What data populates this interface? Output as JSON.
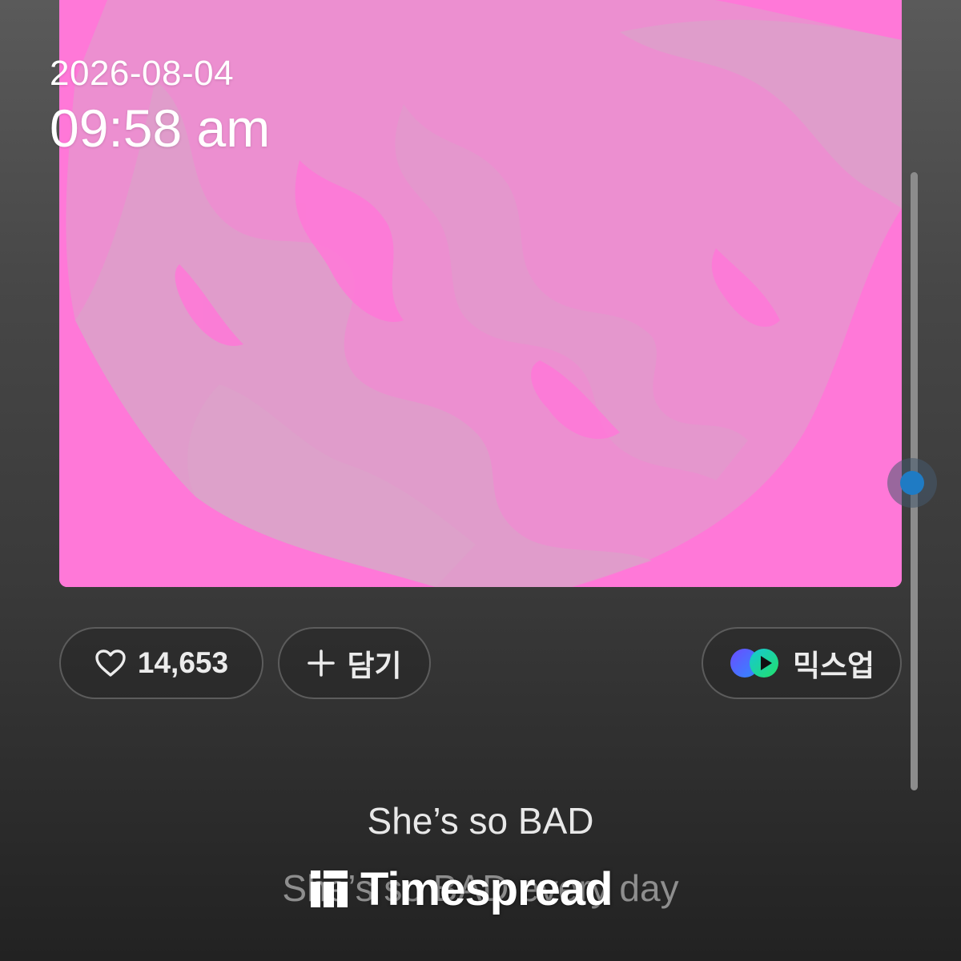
{
  "status": {
    "date": "2026-08-04",
    "time": "09:58 am"
  },
  "album": {
    "art_color": "#ff78d8"
  },
  "actions": {
    "like_count": "14,653",
    "like_icon": "heart-icon",
    "add_label": "담기",
    "add_icon": "plus-icon",
    "mixup_label": "믹스업",
    "mixup_icon": "mixup-icon"
  },
  "lyrics": {
    "current": "She’s so BAD",
    "next": "She’s so BAD every day"
  },
  "watermark": {
    "text": "Timespread"
  },
  "scroll": {
    "position": 0.5
  }
}
